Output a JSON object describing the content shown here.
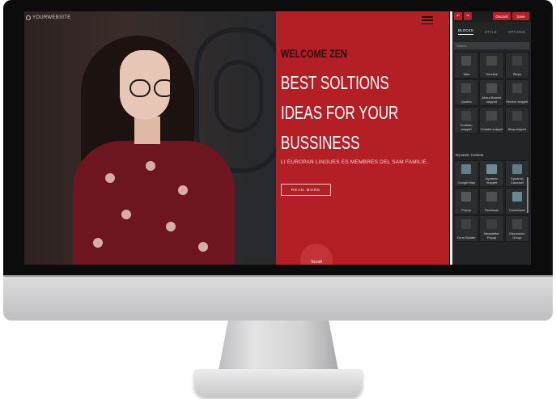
{
  "site": {
    "logo_text": "YOURWEBSITE",
    "welcome": "WELCOME ZEN",
    "headline_lines": [
      "BEST SOLTIONS",
      "IDEAS FOR YOUR",
      "BUSSINESS"
    ],
    "subtitle": "LI EUROPAN LINGUES ES MEMBRES DEL SAM FAMILIE.",
    "read_more": "READ MORE",
    "scroll_label": "Scroll",
    "accent_color": "#b41f25"
  },
  "panel": {
    "toolbar": {
      "undo_icon": "↶",
      "redo_icon": "↷",
      "discard": "Discard",
      "save": "Save"
    },
    "tabs": [
      {
        "label": "BLOCKS",
        "active": true
      },
      {
        "label": "STYLE",
        "active": false
      },
      {
        "label": "OPTIONS",
        "active": false
      }
    ],
    "search_placeholder": "Search",
    "blocks_group1": [
      "Tabs",
      "Timeline",
      "Steps",
      "Quotes",
      "About Banner snippet",
      "Service snippet",
      "Portfolio snippet",
      "Contact snippet",
      "Blog snippet"
    ],
    "section_title": "Dynamic Content",
    "blocks_group2": [
      "Google Map",
      "Dynamic Snippet",
      "Dynamic Carousel",
      "Popup",
      "Facebook",
      "Countdown",
      "Form Builder",
      "Newsletter Popup",
      "Discussion Group"
    ]
  }
}
